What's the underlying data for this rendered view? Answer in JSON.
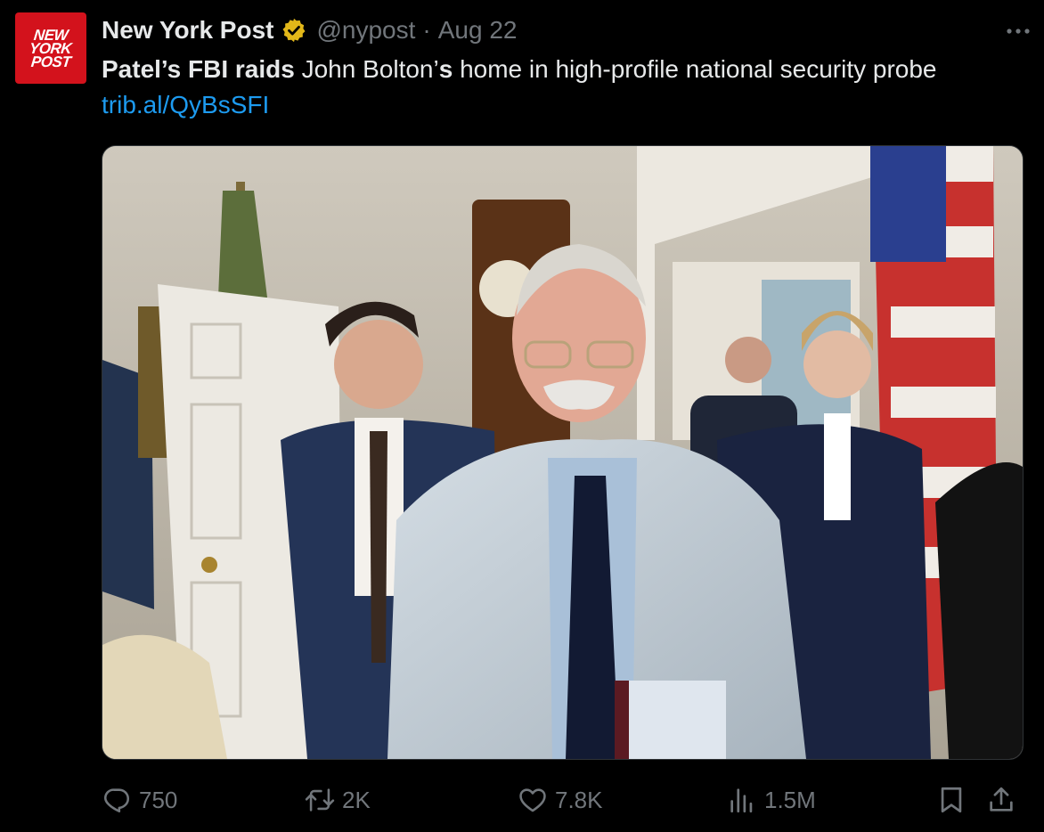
{
  "author": {
    "avatar_text": [
      "NEW",
      "YORK",
      "POST"
    ],
    "display_name": "New York Post",
    "handle": "@nypost",
    "separator": "·",
    "date": "Aug 22",
    "verified_icon": "gold-verified-badge-icon"
  },
  "tweet": {
    "text_bold_1": "Patel’s FBI raids",
    "text_plain_1": " John Bolton’",
    "text_bold_2": "s",
    "text_plain_2": " home in high-profile national security probe",
    "link": "trib.al/QyBsSFI"
  },
  "media": {
    "kind": "photo"
  },
  "actions": {
    "reply_count": "750",
    "retweet_count": "2K",
    "like_count": "7.8K",
    "view_count": "1.5M",
    "icons": [
      "reply-icon",
      "retweet-icon",
      "like-icon",
      "views-icon",
      "bookmark-icon",
      "share-icon"
    ]
  },
  "colors": {
    "background": "#000000",
    "text": "#e7e9ea",
    "muted": "#71767b",
    "link": "#1d9bf0",
    "brand_red": "#d3121c",
    "verified_gold": "#e2b719"
  }
}
